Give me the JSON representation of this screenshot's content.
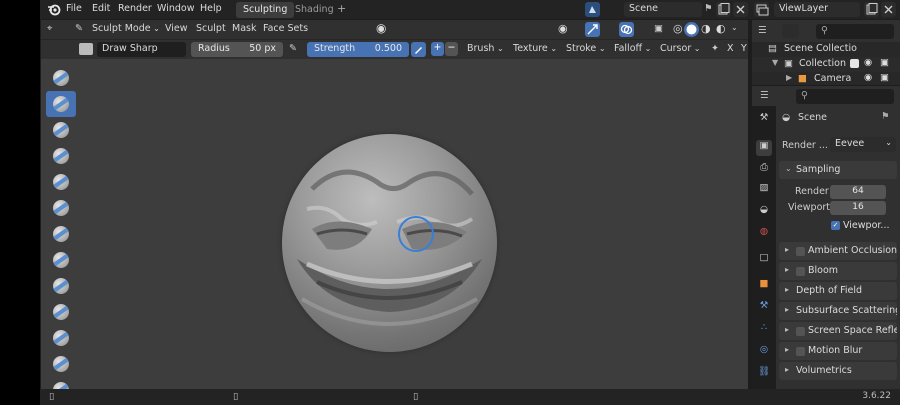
{
  "menu": {
    "items": [
      "File",
      "Edit",
      "Render",
      "Window",
      "Help"
    ],
    "workspaces": [
      {
        "label": "Sculpting",
        "active": true
      },
      {
        "label": "Shading",
        "active": false
      }
    ],
    "add_tab_label": "+",
    "scene_name": "Scene",
    "view_layer_name": "ViewLayer"
  },
  "viewport_header": {
    "mode": "Sculpt Mode",
    "menus": [
      "View",
      "Sculpt",
      "Mask",
      "Face Sets"
    ]
  },
  "tool_settings": {
    "brush_name": "Draw Sharp",
    "radius_label": "Radius",
    "radius_value": "50 px",
    "strength_label": "Strength",
    "strength_value": "0.500",
    "plus_label": "+",
    "minus_label": "−",
    "menus": [
      "Brush",
      "Texture",
      "Stroke",
      "Falloff",
      "Cursor"
    ],
    "axis_x": "X",
    "axis_y": "Y"
  },
  "outliner": {
    "rows": [
      {
        "label": "Scene Collectio",
        "icon": "scene-collection-icon"
      },
      {
        "label": "Collection",
        "icon": "collection-icon"
      },
      {
        "label": "Camera",
        "icon": "camera-icon"
      }
    ]
  },
  "properties": {
    "context_name": "Scene",
    "render_engine_label": "Render ...",
    "render_engine_value": "Eevee",
    "sampling": {
      "title": "Sampling",
      "render_label": "Render",
      "render_value": "64",
      "viewport_label": "Viewport",
      "viewport_value": "16",
      "denoise_label": "Viewpor..."
    },
    "panels": [
      {
        "label": "Ambient Occlusion",
        "checkbox": true
      },
      {
        "label": "Bloom",
        "checkbox": true
      },
      {
        "label": "Depth of Field",
        "checkbox": false
      },
      {
        "label": "Subsurface Scattering",
        "checkbox": false
      },
      {
        "label": "Screen Space Reflecti",
        "checkbox": true
      },
      {
        "label": "Motion Blur",
        "checkbox": true
      },
      {
        "label": "Volumetrics",
        "checkbox": false
      }
    ]
  },
  "status": {
    "version": "3.6.22"
  },
  "colors": {
    "accent": "#4772b3",
    "brush_ring": "#3a7fd6",
    "viewport_bg": "#3d3d3d"
  }
}
